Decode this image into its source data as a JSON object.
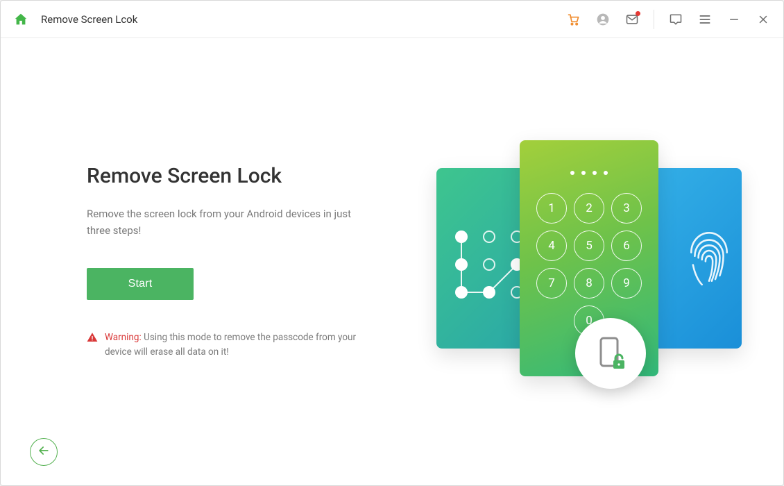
{
  "titlebar": {
    "title": "Remove Screen Lcok"
  },
  "main": {
    "heading": "Remove Screen Lock",
    "description": "Remove the screen lock from your Android devices in just three steps!",
    "start_label": "Start",
    "warning_label": "Warning:",
    "warning_text": " Using this mode to remove the passcode from your device will erase all data on it!"
  },
  "keypad": {
    "keys": [
      "1",
      "2",
      "3",
      "4",
      "5",
      "6",
      "7",
      "8",
      "9",
      "0"
    ]
  },
  "colors": {
    "accent": "#4bb462",
    "danger": "#d93838"
  }
}
